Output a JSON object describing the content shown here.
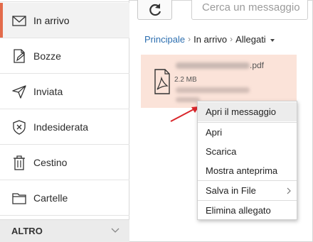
{
  "sidebar": {
    "items": [
      {
        "label": "In arrivo",
        "icon": "envelope-icon"
      },
      {
        "label": "Bozze",
        "icon": "draft-icon"
      },
      {
        "label": "Inviata",
        "icon": "send-icon"
      },
      {
        "label": "Indesiderata",
        "icon": "spam-shield-icon"
      },
      {
        "label": "Cestino",
        "icon": "trash-icon"
      },
      {
        "label": "Cartelle",
        "icon": "folder-icon"
      }
    ],
    "altro_label": "ALTRO"
  },
  "toolbar": {
    "search_placeholder": "Cerca un messaggio"
  },
  "breadcrumb": {
    "root": "Principale",
    "folder": "In arrivo",
    "current": "Allegati"
  },
  "attachment": {
    "ext": ".pdf",
    "size": "2.2 MB"
  },
  "context_menu": {
    "items": [
      "Apri il messaggio",
      "Apri",
      "Scarica",
      "Mostra anteprima",
      "Salva in File",
      "Elimina allegato"
    ]
  },
  "colors": {
    "accent": "#e36b4b",
    "link": "#2d6fb0",
    "attachment_bg": "#fbe3d9",
    "annotation_arrow": "#d9262b"
  }
}
